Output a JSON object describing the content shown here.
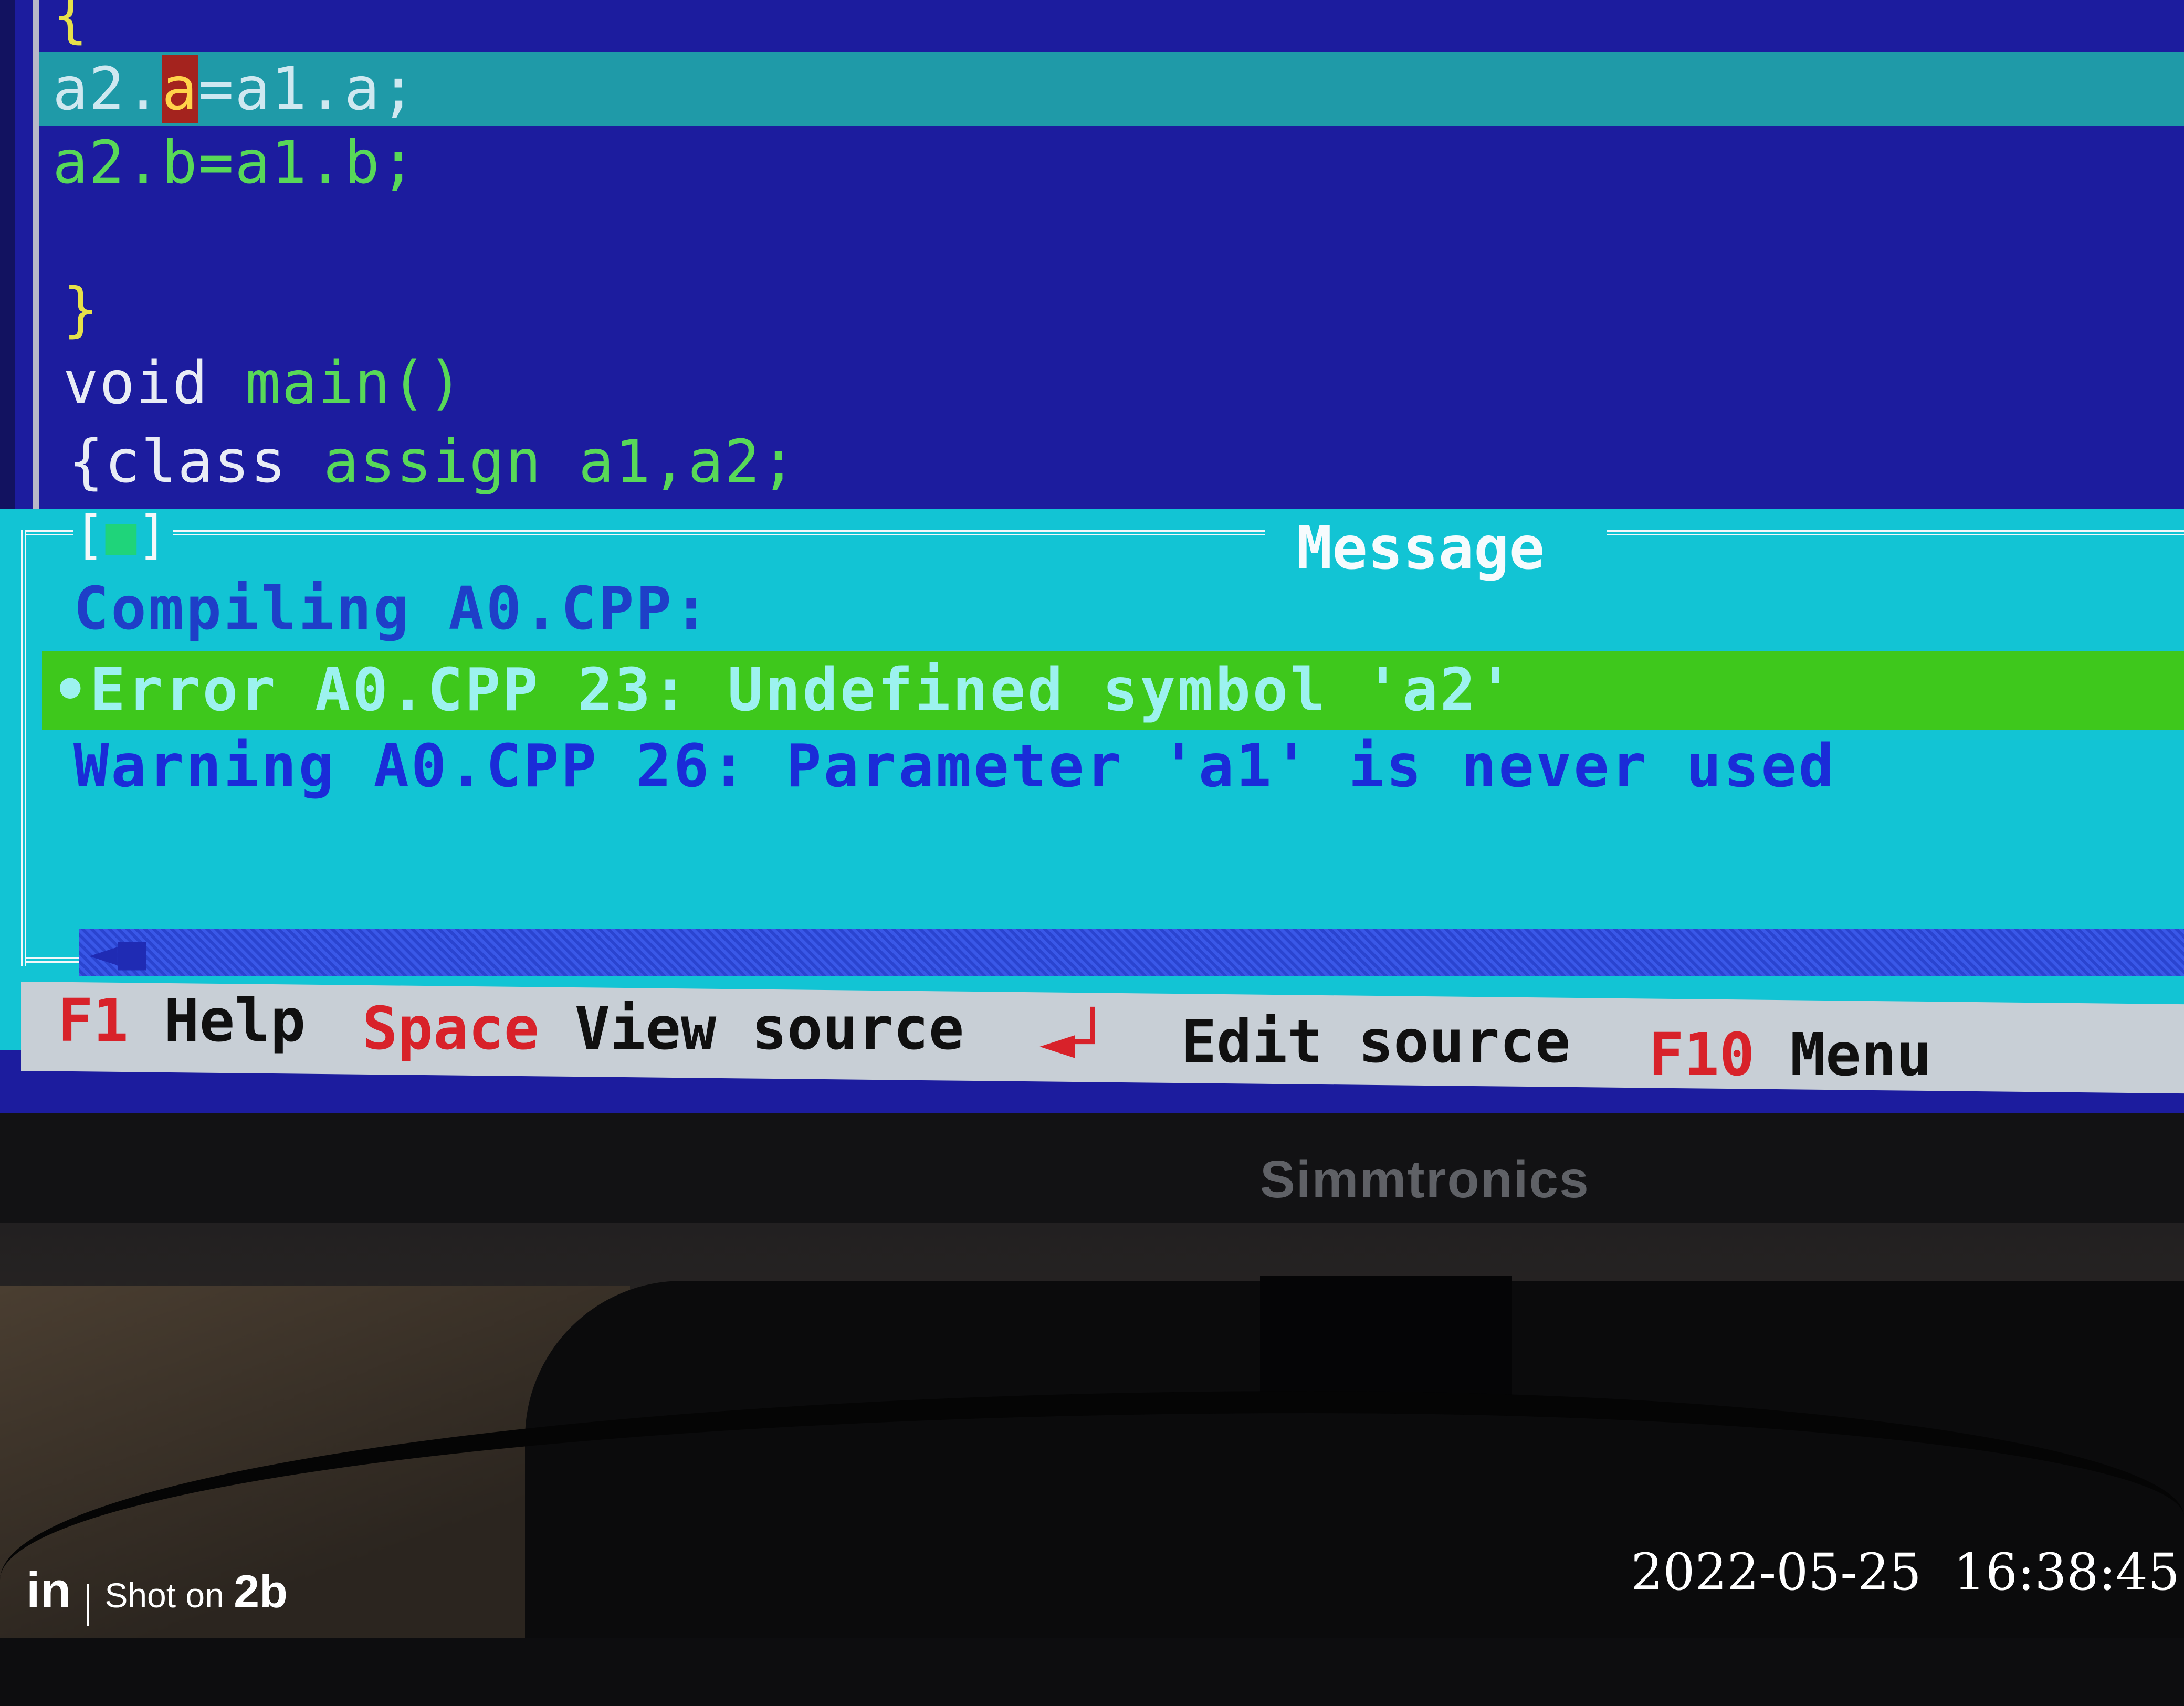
{
  "editor": {
    "line_top": "{",
    "line_current_prefix": "a2.",
    "line_current_cursor": "a",
    "line_current_suffix": "=a1.a;",
    "line_b": "a2.b=a1.b;",
    "line_close": "}",
    "line_void_kw": "void",
    "line_void_fn": "main()",
    "line_class_kw": "{class",
    "line_class_rest": "assign a1,a2;"
  },
  "message_window": {
    "close_box": "[",
    "close_dot": "■",
    "close_end": "]",
    "title": "Message",
    "messages": [
      "Compiling A0.CPP:",
      "•Error A0.CPP 23: Undefined symbol 'a2'",
      "Warning A0.CPP 26: Parameter 'a1' is never used"
    ],
    "scroll_left": "◄■"
  },
  "status_bar": {
    "f1_key": "F1",
    "f1_label": "Help",
    "space_key": "Space",
    "space_label": "View source",
    "enter_key": "◄┘",
    "enter_label": "Edit source",
    "f10_key": "F10",
    "f10_label": "Menu"
  },
  "monitor": {
    "brand": "Simmtronics"
  },
  "photo": {
    "watermark_logo": "in",
    "watermark_shot": "Shot on ",
    "watermark_model": "2b",
    "timestamp": "2022-05-25  16:38:45"
  },
  "colors": {
    "editor_bg": "#1c1c9e",
    "message_bg": "#12c4d4",
    "error_highlight": "#3ec81c",
    "status_bar_bg": "#c8cfd6",
    "hotkey": "#d8222a"
  }
}
